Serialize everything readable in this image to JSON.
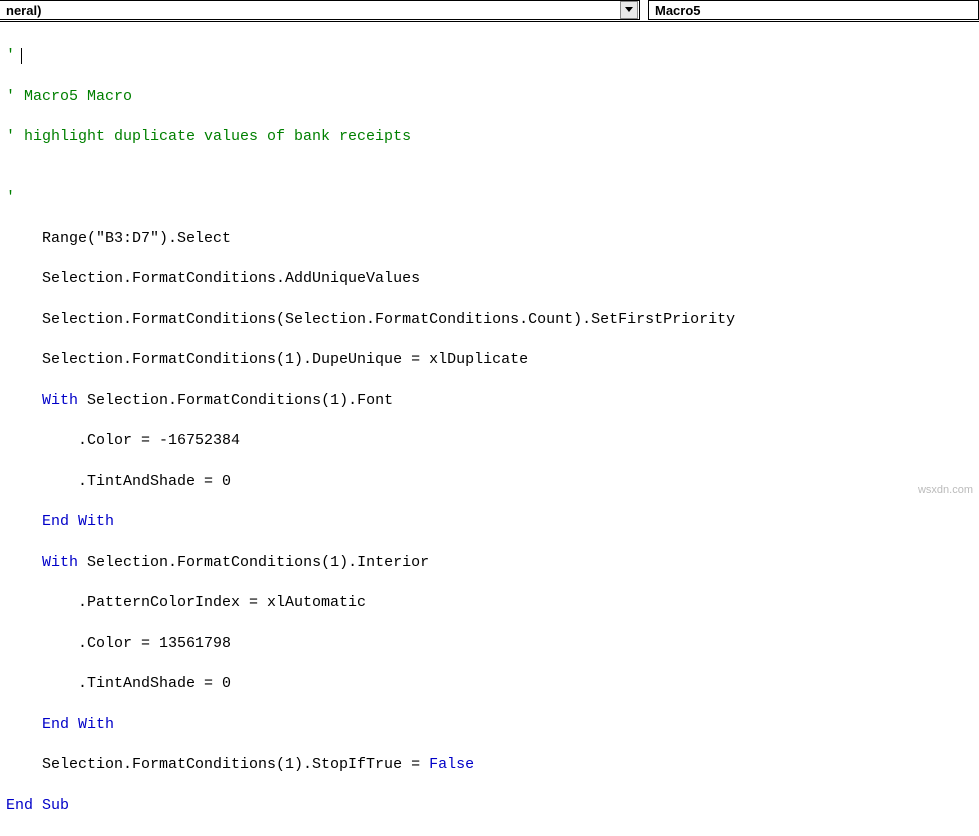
{
  "toolbar": {
    "object_selector": "neral)",
    "procedure_selector": "Macro5"
  },
  "code": {
    "l0_cursor": "'",
    "l1": "' Macro5 Macro",
    "l2": "' highlight duplicate values of bank receipts",
    "l3": "",
    "l4": "'",
    "l5": "    Range(\"B3:D7\").Select",
    "l6": "    Selection.FormatConditions.AddUniqueValues",
    "l7": "    Selection.FormatConditions(Selection.FormatConditions.Count).SetFirstPriority",
    "l8": "    Selection.FormatConditions(1).DupeUnique = xlDuplicate",
    "l9a": "    ",
    "l9_kw": "With",
    "l9b": " Selection.FormatConditions(1).Font",
    "l10": "        .Color = -16752384",
    "l11": "        .TintAndShade = 0",
    "l12a": "    ",
    "l12_kw": "End With",
    "l13a": "    ",
    "l13_kw": "With",
    "l13b": " Selection.FormatConditions(1).Interior",
    "l14": "        .PatternColorIndex = xlAutomatic",
    "l15": "        .Color = 13561798",
    "l16": "        .TintAndShade = 0",
    "l17a": "    ",
    "l17_kw": "End With",
    "l18a": "    Selection.FormatConditions(1).StopIfTrue = ",
    "l18_kw": "False",
    "l19_kw": "End Sub"
  },
  "watermark": "wsxdn.com"
}
